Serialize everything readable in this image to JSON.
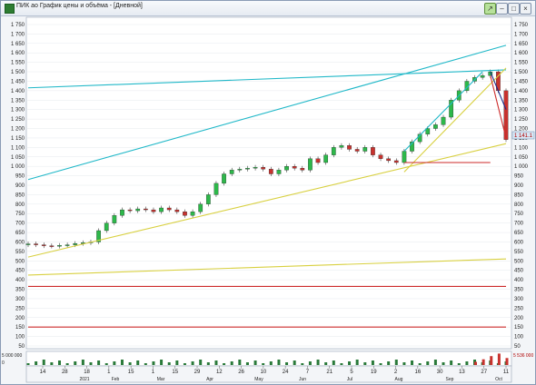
{
  "window": {
    "title": "ПИК ао График цены и объёма - [Дневной]",
    "buttons": [
      {
        "name": "chart-mode-button",
        "label": "↗",
        "active": true
      },
      {
        "name": "minimize-button",
        "label": "–"
      },
      {
        "name": "maximize-button",
        "label": "□"
      },
      {
        "name": "close-button",
        "label": "×"
      }
    ]
  },
  "price_axis": {
    "labels": [
      "1 750",
      "1 700",
      "1 650",
      "1 600",
      "1 550",
      "1 500",
      "1 450",
      "1 400",
      "1 350",
      "1 300",
      "1 250",
      "1 200",
      "1 150",
      "1 100",
      "1 050",
      "1 000",
      "950",
      "900",
      "850",
      "800",
      "750",
      "700",
      "650",
      "600",
      "550",
      "500",
      "450",
      "400",
      "350",
      "300",
      "250",
      "200",
      "150",
      "100",
      "50"
    ],
    "last_price": "1 141.1"
  },
  "volume_axis": {
    "left_label": "5 000 000",
    "right_label": "5 536 000",
    "zero": "0"
  },
  "time_axis": {
    "labels": [
      "14",
      "28",
      "18",
      "1",
      "15",
      "1",
      "15",
      "29",
      "12",
      "26",
      "10",
      "24",
      "7",
      "21",
      "5",
      "19",
      "2",
      "16",
      "30",
      "13",
      "27",
      "11"
    ],
    "months": [
      "2021",
      "Feb",
      "Mar",
      "Apr",
      "May",
      "Jun",
      "Jul",
      "Aug",
      "Sep",
      "Oct"
    ]
  },
  "chart_data": {
    "type": "candlestick",
    "instrument": "ПИК ао",
    "timeframe": "Дневной",
    "ylim": [
      50,
      1750
    ],
    "closes": [
      590,
      585,
      580,
      578,
      582,
      585,
      592,
      596,
      600,
      660,
      700,
      740,
      770,
      765,
      775,
      770,
      760,
      780,
      770,
      760,
      740,
      760,
      800,
      850,
      910,
      960,
      980,
      985,
      990,
      995,
      985,
      960,
      980,
      1000,
      990,
      980,
      1040,
      1020,
      1060,
      1100,
      1110,
      1090,
      1080,
      1100,
      1060,
      1040,
      1030,
      1020,
      1080,
      1130,
      1170,
      1200,
      1220,
      1260,
      1350,
      1400,
      1450,
      1470,
      1480,
      1500,
      1400,
      1141
    ],
    "last_close": 1141.1,
    "trendlines": [
      {
        "color": "#20b8c8",
        "from": [
          0,
          930
        ],
        "to": [
          61,
          1640
        ]
      },
      {
        "color": "#20b8c8",
        "from": [
          0,
          1415
        ],
        "to": [
          61,
          1510
        ]
      },
      {
        "color": "#20b8c8",
        "from": [
          48,
          1080
        ],
        "to": [
          58,
          1500
        ]
      },
      {
        "color": "#d8d040",
        "from": [
          0,
          520
        ],
        "to": [
          61,
          1120
        ]
      },
      {
        "color": "#d8d040",
        "from": [
          0,
          425
        ],
        "to": [
          61,
          510
        ]
      },
      {
        "color": "#d8d040",
        "from": [
          48,
          970
        ],
        "to": [
          61,
          1520
        ]
      },
      {
        "color": "#cc2a2a",
        "from": [
          0,
          365
        ],
        "to": [
          61,
          365
        ]
      },
      {
        "color": "#cc2a2a",
        "from": [
          0,
          150
        ],
        "to": [
          61,
          150
        ]
      },
      {
        "color": "#cc2a2a",
        "from": [
          48,
          1020
        ],
        "to": [
          59,
          1020
        ]
      },
      {
        "color": "#1a2a8a",
        "from": [
          59,
          1500
        ],
        "to": [
          61,
          1300
        ]
      },
      {
        "color": "#cc2a2a",
        "from": [
          59,
          1480
        ],
        "to": [
          61,
          1150
        ]
      }
    ],
    "volume_spikes_last": [
      0.25,
      0.45,
      0.7,
      0.9,
      0.55
    ]
  }
}
